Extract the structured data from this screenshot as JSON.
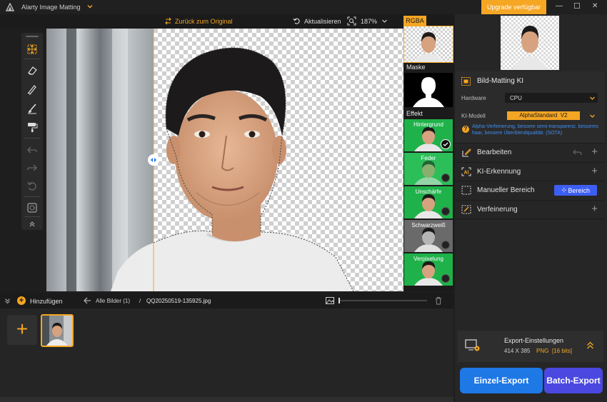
{
  "window": {
    "title": "Alarty Image Matting",
    "upgrade_label": "Upgrade verfügbar",
    "minimize": "—",
    "maximize": "☐",
    "close": "✕"
  },
  "topbar": {
    "back_label": "Zurück zum Original",
    "refresh_label": "Aktualisieren",
    "zoom": "187%"
  },
  "preview": {
    "rgba_label": "RGBA",
    "mask_label": "Maske",
    "effect_label": "Effekt",
    "effects": [
      {
        "label": "Hintergrund"
      },
      {
        "label": "Feder"
      },
      {
        "label": "Unschärfe"
      },
      {
        "label": "Schwarzweiß"
      },
      {
        "label": "Verpixelung"
      }
    ]
  },
  "panel": {
    "matting_title": "Bild-Matting KI",
    "hardware_label": "Hardware",
    "hardware_value": "CPU",
    "model_label": "KI-Modell",
    "model_value": "AlphaStandard  V2",
    "model_desc": "Alpha-Verfeinerung, bessere semi-transparenz, besseres haar, bessere Überblendqualität. (SOTA)",
    "sections": [
      {
        "label": "Bearbeiten"
      },
      {
        "label": "KI-Erkennung"
      },
      {
        "label": "Manueller Bereich",
        "button": "Bereich"
      },
      {
        "label": "Verfeinerung"
      }
    ],
    "export_title": "Export-Einstellungen",
    "export_size": "414 X 385",
    "export_format": "PNG",
    "export_bits": "[16 bits]",
    "single_export": "Einzel-Export",
    "batch_export": "Batch-Export"
  },
  "bottom": {
    "add_label": "Hinzufügen",
    "all_images": "Alle Bilder (1)",
    "separator": "/",
    "filename": "QQ20250519-135925.jpg"
  },
  "colors": {
    "accent": "#f5a623",
    "green": "#1fb24a",
    "single_blue": "#1e78e6",
    "batch_purple": "#4a48e0",
    "range_blue": "#3d5ef2"
  }
}
